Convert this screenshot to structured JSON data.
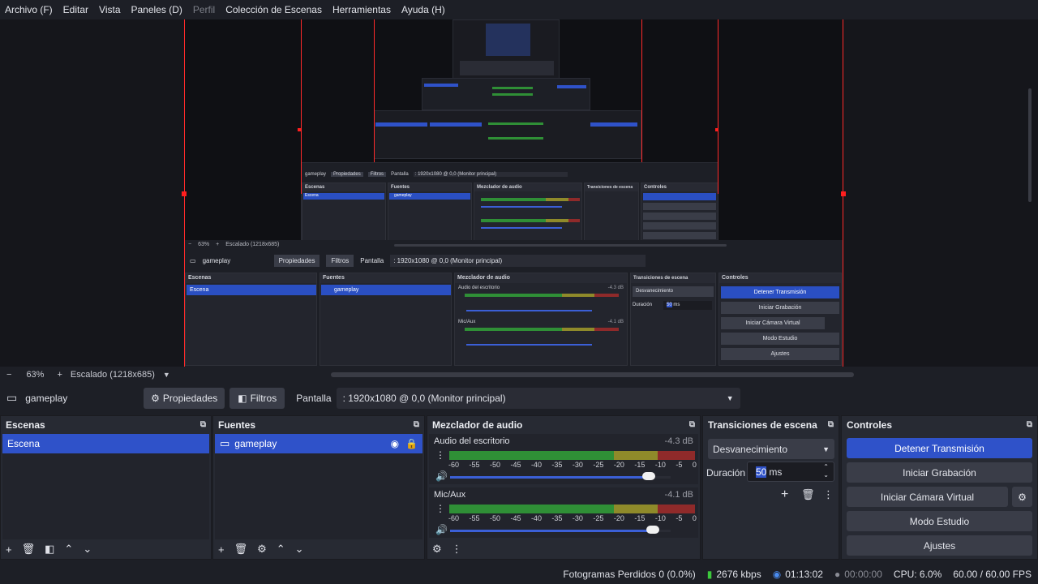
{
  "menu": [
    "Archivo (F)",
    "Editar",
    "Vista",
    "Paneles (D)",
    "Perfil",
    "Colección de Escenas",
    "Herramientas",
    "Ayuda (H)"
  ],
  "preview": {
    "nested": {
      "source": "gameplay",
      "properties": "Propiedades",
      "filters": "Filtros",
      "screen": "Pantalla",
      "screen_value": ": 1920x1080 @ 0,0 (Monitor principal)",
      "scenes": "Escenas",
      "scene_item": "Escena",
      "sources": "Fuentes",
      "mixer": "Mezclador de audio",
      "desktop_audio": "Audio del escritorio",
      "desktop_db": "-4.3 dB",
      "mic": "Mic/Aux",
      "mic_db": "-4.1 dB",
      "transitions": "Transiciones de escena",
      "fade": "Desvanecimiento",
      "duration": "Duración",
      "duration_value": "50",
      "duration_unit": "ms",
      "controls": "Controles",
      "stop_stream": "Detener Transmisión",
      "start_rec": "Iniciar Grabación",
      "start_vcam": "Iniciar Cámara Virtual",
      "studio": "Modo Estudio",
      "settings": "Ajustes",
      "zoom": "63%",
      "scaled": "Escalado (1218x685)"
    }
  },
  "zoombar": {
    "minus": "−",
    "zoom": "63%",
    "plus": "+",
    "scaled": "Escalado (1218x685)"
  },
  "sourcebar": {
    "source_name": "gameplay",
    "properties": "Propiedades",
    "filters": "Filtros",
    "screen_label": "Pantalla",
    "screen_value": ": 1920x1080 @ 0,0 (Monitor principal)"
  },
  "scenes": {
    "title": "Escenas",
    "items": [
      "Escena"
    ]
  },
  "sources": {
    "title": "Fuentes",
    "items": [
      "gameplay"
    ]
  },
  "mixer": {
    "title": "Mezclador de audio",
    "ticks": [
      "-60",
      "-55",
      "-50",
      "-45",
      "-40",
      "-35",
      "-30",
      "-25",
      "-20",
      "-15",
      "-10",
      "-5",
      "0"
    ],
    "channels": [
      {
        "name": "Audio del escritorio",
        "db": "-4.3 dB",
        "volume": 0.9
      },
      {
        "name": "Mic/Aux",
        "db": "-4.1 dB",
        "volume": 0.92
      }
    ]
  },
  "transitions": {
    "title": "Transiciones de escena",
    "type": "Desvanecimiento",
    "duration_label": "Duración",
    "duration_value": "50",
    "duration_unit": "ms"
  },
  "controls": {
    "title": "Controles",
    "stop_stream": "Detener Transmisión",
    "start_rec": "Iniciar Grabación",
    "start_vcam": "Iniciar Cámara Virtual",
    "studio": "Modo Estudio",
    "settings": "Ajustes"
  },
  "status": {
    "dropped": "Fotogramas Perdidos 0 (0.0%)",
    "bitrate": "2676 kbps",
    "stream_time": "01:13:02",
    "rec_time": "00:00:00",
    "cpu": "CPU: 6.0%",
    "fps": "60.00 / 60.00 FPS"
  },
  "colors": {
    "accent": "#2f52c9",
    "selection_border": "#ff2a2a",
    "meter_green": "#2f8f36",
    "meter_yellow": "#8f8a2a",
    "meter_red": "#8f2a2a"
  }
}
